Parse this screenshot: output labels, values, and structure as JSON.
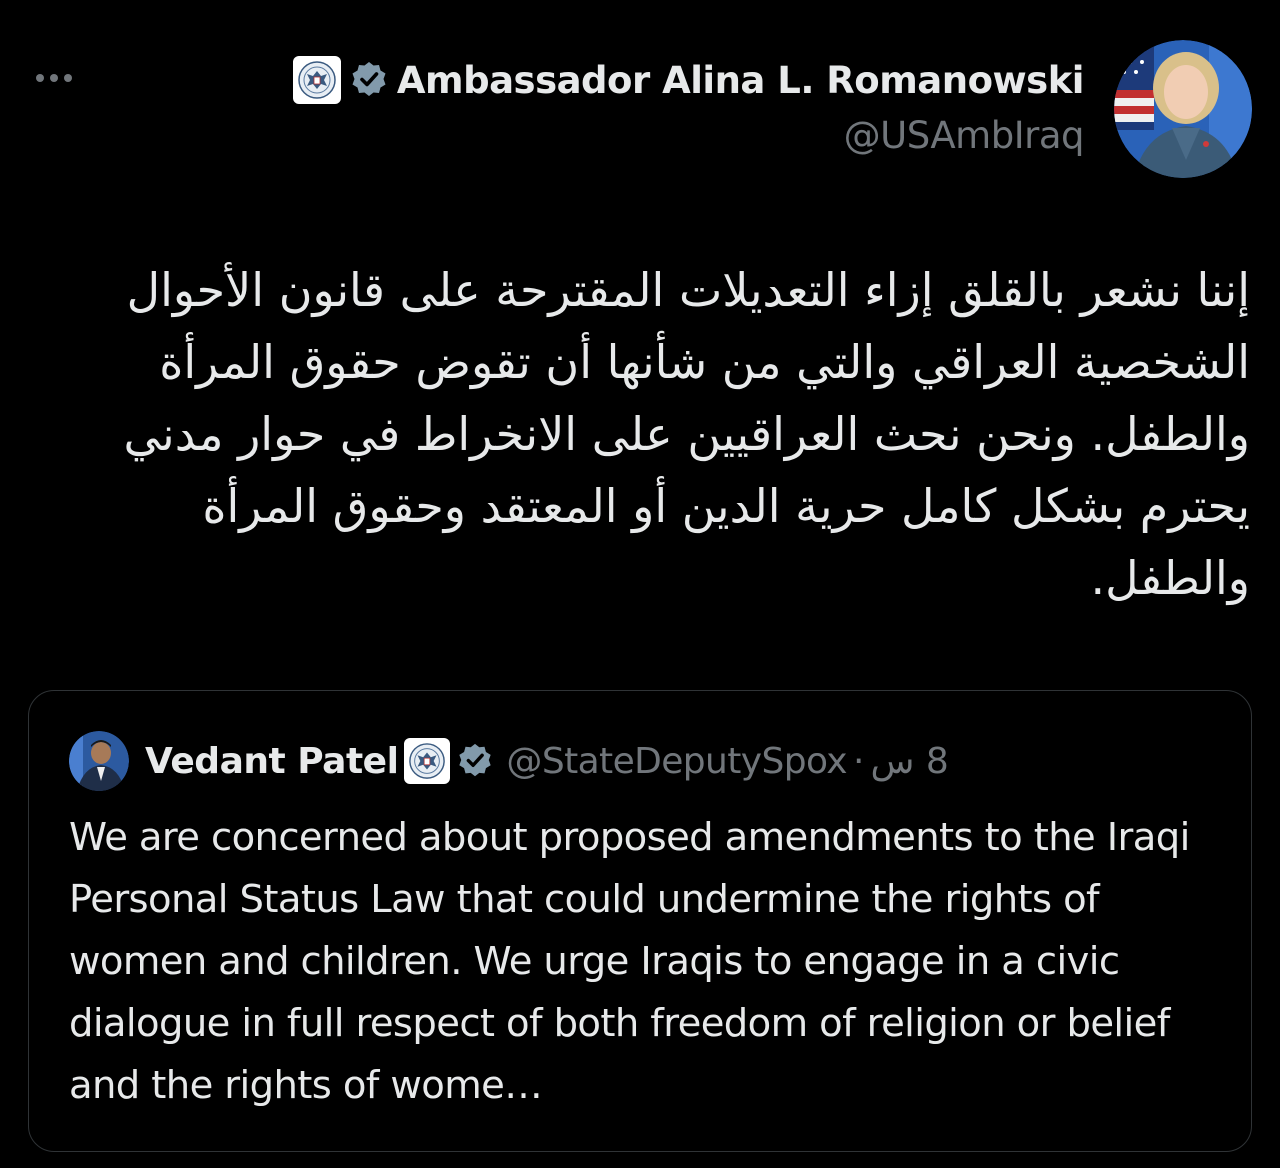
{
  "author": {
    "display_name": "Ambassador Alina L. Romanowski",
    "handle": "@USAmbIraq"
  },
  "tweet": {
    "text": "إننا نشعر بالقلق إزاء التعديلات المقترحة على قانون الأحوال الشخصية العراقي والتي من شأنها أن تقوض حقوق المرأة والطفل. ونحن نحث العراقيين على الانخراط في حوار مدني يحترم بشكل كامل حرية الدين أو المعتقد وحقوق المرأة والطفل."
  },
  "quoted_tweet": {
    "display_name": "Vedant Patel",
    "handle": "@StateDeputySpox",
    "separator": "·",
    "time": "8 س",
    "text": "We are concerned about proposed amendments to the Iraqi Personal Status Law that could undermine the rights of women and children. We urge Iraqis to engage in a civic dialogue in full respect of both freedom of religion or belief and the rights of wome…"
  },
  "icons": {
    "more": "more-horizontal-icon",
    "seal": "us-state-department-seal-icon",
    "verified": "verified-badge-icon"
  },
  "colors": {
    "background": "#000000",
    "text_primary": "#e7e9ea",
    "text_secondary": "#71767b",
    "border": "#2f3336",
    "verified_badge": "#829aab"
  }
}
